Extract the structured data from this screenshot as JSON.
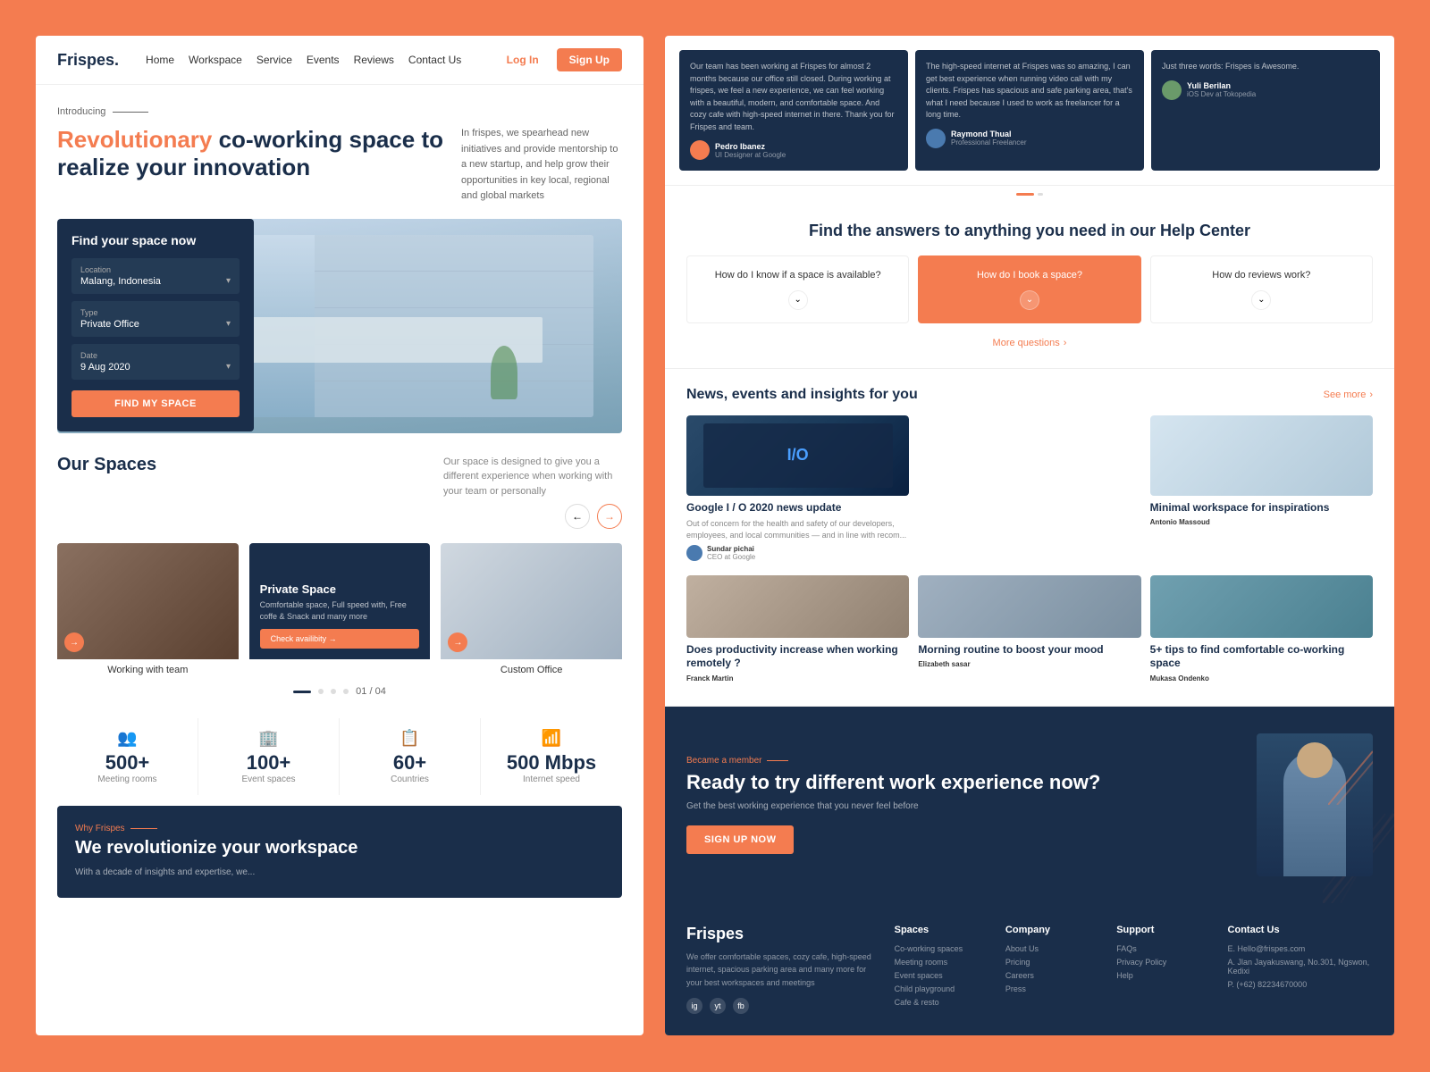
{
  "page": {
    "bg_color": "#F47C50"
  },
  "left": {
    "nav": {
      "logo": "Frispes.",
      "links": [
        "Home",
        "Workspace",
        "Service",
        "Events",
        "Reviews",
        "Contact Us"
      ],
      "login": "Log In",
      "signup": "Sign Up"
    },
    "hero": {
      "introducing": "Introducing",
      "title_accent": "Revolutionary",
      "title_rest": " co-working space to realize your innovation",
      "description": "In frispes, we spearhead new initiatives and provide mentorship to a new startup, and help grow their opportunities in key local, regional and global markets"
    },
    "search": {
      "title": "Find your space now",
      "location_label": "Location",
      "location_value": "Malang, Indonesia",
      "type_label": "Type",
      "type_value": "Private Office",
      "date_label": "Date",
      "date_value": "9 Aug 2020",
      "button": "FIND MY SPACE"
    },
    "spaces": {
      "title": "Our Spaces",
      "description": "Our space is designed to give you a different experience when working with your team or personally",
      "cards": [
        {
          "name": "Working with team",
          "img_class": "news-img-1"
        },
        {
          "name": "Private Space",
          "desc": "Comfortable space, Full speed with, Free coffe & Snack and many more",
          "img_class": "dark-bg"
        },
        {
          "name": "Custom Office",
          "img_class": "img-custom"
        }
      ],
      "page_current": "01",
      "page_total": "04"
    },
    "stats": [
      {
        "icon": "👥",
        "number": "500+",
        "label": "Meeting rooms"
      },
      {
        "icon": "🏢",
        "number": "100+",
        "label": "Event spaces"
      },
      {
        "icon": "📋",
        "number": "60+",
        "label": "Countries"
      },
      {
        "icon": "📶",
        "number": "500 Mbps",
        "label": "Internet speed"
      }
    ],
    "why": {
      "subtitle": "Why Frispes",
      "title": "We revolutionize your workspace",
      "desc": "With a decade of insights and expertise, we..."
    }
  },
  "right": {
    "testimonials": [
      {
        "text": "Our team has been working at Frispes for almost 2 months because our office still closed. During working at frispes, we feel a new experience, we can feel working with a beautiful, modern, and comfortable space. And cozy cafe with high-speed internet in there. Thank you for Frispes and team.",
        "author": "Pedro Ibanez",
        "role": "UI Designer at Google"
      },
      {
        "text": "The high-speed internet at Frispes was so amazing, I can get best experience when running video call with my clients. Frispes has spacious and safe parking area, that's what I need because I used to work as freelancer for a long time.",
        "author": "Raymond Thual",
        "role": "Professional Freelancer"
      },
      {
        "text": "Just three words: Frispes is Awesome.",
        "author": "Yuli Berilan",
        "role": "iOS Dev at Tokopedia"
      }
    ],
    "help": {
      "title": "Find the answers to anything you need in our Help Center",
      "faqs": [
        {
          "question": "How do I know if a space is available?",
          "active": false
        },
        {
          "question": "How do I book a space?",
          "active": true
        },
        {
          "question": "How do reviews work?",
          "active": false
        }
      ],
      "more_questions": "More questions"
    },
    "news": {
      "title": "News, events and insights for you",
      "see_more": "See more",
      "articles": [
        {
          "title": "Google I / O 2020 news update",
          "excerpt": "Out of concern for the health and safety of our developers, employees, and local communities — and in line with recom...",
          "author": "Sundar pichai",
          "role": "CEO at Google",
          "img_class": "news-img-1"
        },
        {
          "title": "",
          "excerpt": "",
          "author": "",
          "role": "",
          "img_class": "news-img-2"
        },
        {
          "title": "Minimal workspace for inspirations",
          "excerpt": "",
          "author": "Antonio Massoud",
          "role": "",
          "img_class": "news-img-3"
        },
        {
          "title": "Does productivity increase when working remotely ?",
          "excerpt": "",
          "author": "Franck Martin",
          "role": "",
          "img_class": "news-img-4"
        },
        {
          "title": "Morning routine to boost your mood",
          "excerpt": "",
          "author": "Elizabeth sasar",
          "role": "",
          "img_class": "news-img-5"
        },
        {
          "title": "5+ tips to find comfortable co-working space",
          "excerpt": "",
          "author": "Mukasa Ondenko",
          "role": "",
          "img_class": "news-img-6"
        }
      ]
    },
    "cta": {
      "became": "Became a member",
      "title": "Ready to try different work experience now?",
      "desc": "Get the best working experience that you never feel before",
      "button": "SIGN UP NOW"
    },
    "footer": {
      "logo": "Frispes",
      "desc": "We offer comfortable spaces, cozy cafe, high-speed internet, spacious parking area and many more for your best workspaces and meetings",
      "social": [
        "ig",
        "yt",
        "fb"
      ],
      "columns": [
        {
          "title": "Spaces",
          "links": [
            "Co-working spaces",
            "Meeting rooms",
            "Event spaces",
            "Child playground",
            "Cafe & resto"
          ]
        },
        {
          "title": "Company",
          "links": [
            "About Us",
            "Pricing",
            "Careers",
            "Press"
          ]
        },
        {
          "title": "Support",
          "links": [
            "FAQs",
            "Privacy Policy",
            "Help"
          ]
        },
        {
          "title": "Contact Us",
          "links": [
            "E. Hello@frispes.com",
            "A. Jlan Jayakuswang, No.301, Ngswon, Kedixi",
            "P. (+62) 82234670000"
          ]
        }
      ]
    }
  }
}
